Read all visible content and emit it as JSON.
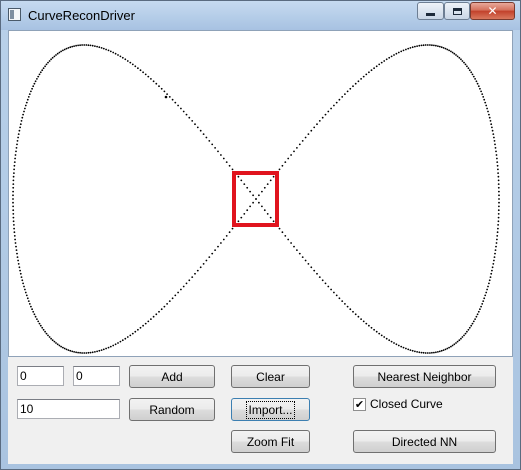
{
  "window": {
    "title": "CurveReconDriver",
    "controls": [
      "minimize",
      "maximize",
      "close"
    ]
  },
  "canvas": {
    "curve": "figure-eight (lemniscate) point set",
    "isolated_point": true,
    "highlight": {
      "shape": "rectangle",
      "color": "#e0141e",
      "around": "curve crossing"
    }
  },
  "inputs": {
    "x_value": "0",
    "y_value": "0",
    "count_value": "10"
  },
  "buttons": {
    "add": "Add",
    "random": "Random",
    "clear": "Clear",
    "import": "Import...",
    "zoom_fit": "Zoom Fit",
    "nearest_neighbor": "Nearest Neighbor",
    "directed_nn": "Directed NN"
  },
  "checkbox": {
    "closed_curve_label": "Closed Curve",
    "closed_curve_checked": true
  },
  "colors": {
    "titlebar": "#b5cde8",
    "close_button": "#c2412b",
    "panel": "#f0f0f0",
    "highlight_box": "#e0141e"
  }
}
